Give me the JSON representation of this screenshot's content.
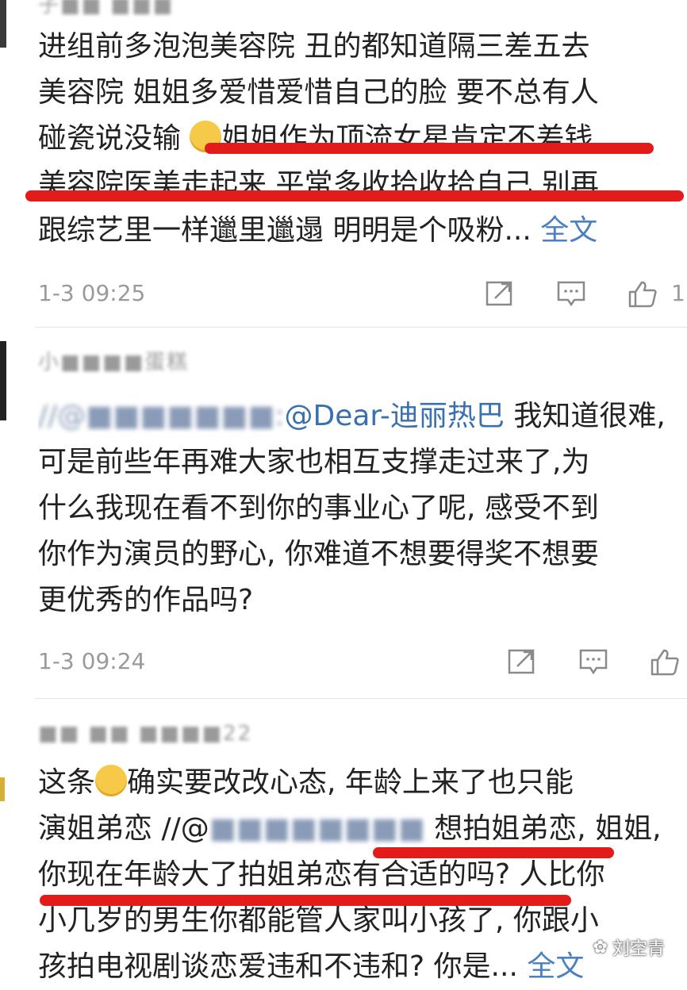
{
  "comments": [
    {
      "username": "子■■ ■■■",
      "lines": [
        "进组前多泡泡美容院 丑的都知道隔三差五去",
        "美容院  姐姐多爱惜爱惜自己的脸 要不总有人",
        "碰瓷说没输",
        "姐姐作为顶流女星肯定不差钱",
        "美容院医美走起来 平常多收拾收拾自己 别再",
        "跟综艺里一样邋里邋遢 明明是个吸粉..."
      ],
      "more": "全文",
      "time": "1-3 09:25",
      "like_count": "1"
    },
    {
      "username": "小■■■■蛋糕",
      "mention_prefix": "//@■■■■■■■:",
      "mention": "@Dear-迪丽热巴",
      "lines": [
        "我知道很难,",
        "可是前些年再难大家也相互支撑走过来了,为",
        "什么我现在看不到你的事业心了呢, 感受不到",
        "你作为演员的野心, 你难道不想要得奖不想要",
        "更优秀的作品吗?"
      ],
      "time": "1-3 09:24"
    },
    {
      "username": "■■ ■■ ■■■■22",
      "lines": [
        "这条",
        "确实要改改心态, 年龄上来了也只能",
        "演姐弟恋 //@",
        "想拍姐弟恋, 姐姐,",
        "你现在年龄大了拍姐弟恋有合适的吗? 人比你",
        "小几岁的男生你都能管人家叫小孩了, 你跟小",
        "孩拍电视剧谈恋爱违和不违和? 你是..."
      ],
      "more": "全文"
    }
  ],
  "watermark": "刘空青",
  "colors": {
    "underline": "#e21b1b",
    "link": "#4a7fc1"
  }
}
